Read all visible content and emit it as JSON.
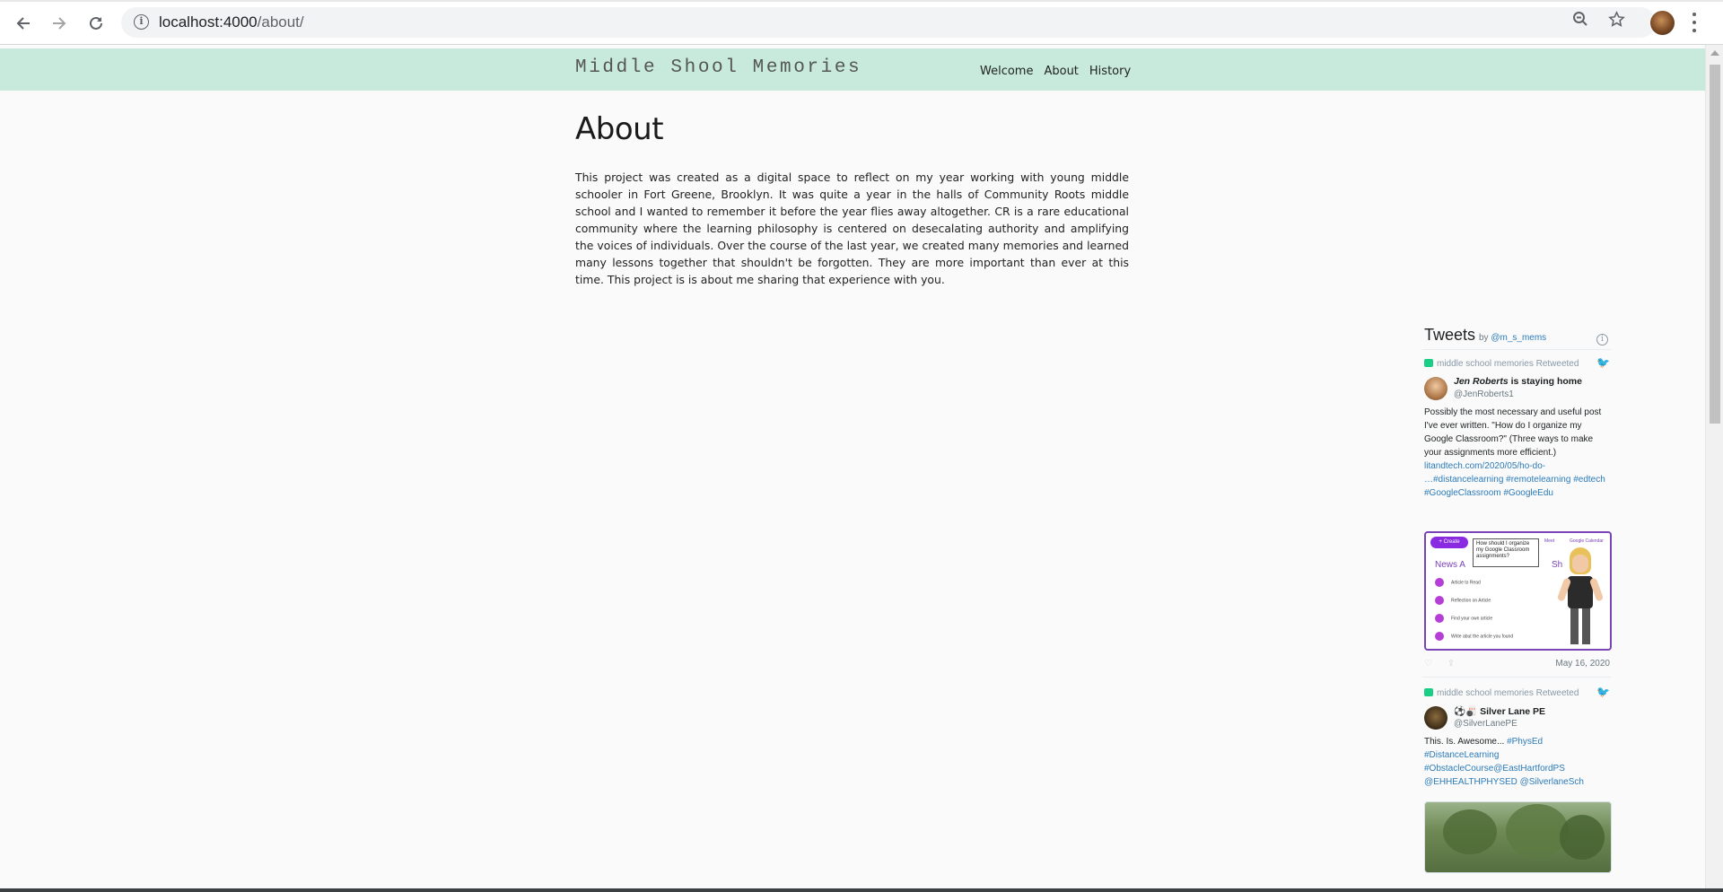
{
  "browser": {
    "url_host": "localhost:4000",
    "url_path": "/about/",
    "icons": {
      "back": "arrow-left-icon",
      "forward": "arrow-right-icon",
      "reload": "reload-icon",
      "site_info": "info-icon",
      "zoom": "zoom-out-icon",
      "bookmark": "star-icon",
      "menu": "kebab-menu-icon"
    }
  },
  "site": {
    "title": "Middle Shool Memories",
    "nav": [
      "Welcome",
      "About",
      "History"
    ],
    "header_color": "#c7eadd"
  },
  "page": {
    "heading": "About",
    "body": "This project was created as a digital space to reflect on my year working with young middle schooler in Fort Greene, Brooklyn. It was quite a year in the halls of Community Roots middle school and I wanted to remember it before the year flies away altogether. CR is a rare educational community where the learning philosophy is centered on desecalating authority and amplifying the voices of individuals. Over the course of the last year, we created many memories and learned many lessons together that shouldn't be forgotten. They are more important than ever at this time. This project is is about me sharing that experience with you."
  },
  "timeline": {
    "title": "Tweets",
    "by_prefix": "by",
    "by_handle": "@m_s_mems",
    "tweets": [
      {
        "retweet_label": "middle school memories Retweeted",
        "author_name": "Jen Roberts",
        "author_suffix": " is staying home",
        "handle": "@JenRoberts1",
        "text_lines": [
          "Possibly the most necessary and useful post",
          "I've ever written. \"How do I organize my",
          "Google Classroom?\" (Three ways to make",
          "your assignments more efficient.)"
        ],
        "links_lines": [
          "litandtech.com/2020/05/ho-do-",
          "…#distancelearning #remotelearning #edtech",
          "#GoogleClassroom #GoogleEdu"
        ],
        "media": {
          "create_label": "Create",
          "meet_label": "Meet",
          "calendar_label": "Google Calendar",
          "bubble_text": "How should I organize my Google Classroom assignments?",
          "heading": "News A",
          "heading_tail": "Sh",
          "items": [
            "Article to Read",
            "Reflection on Article",
            "Find your own article",
            "Write abut the article you found"
          ]
        },
        "date": "May 16, 2020"
      },
      {
        "retweet_label": "middle school memories Retweeted",
        "author_name": "⚽🎳 Silver Lane PE",
        "author_suffix": "",
        "handle": "@SilverLanePE",
        "text_plain": "This. Is. Awesome... ",
        "text_tags_lines": [
          "#PhysEd",
          "#DistanceLearning",
          "#ObstacleCourse@EastHartfordPS",
          "@EHHEALTHPHYSED @SilverlaneSch"
        ]
      }
    ]
  }
}
